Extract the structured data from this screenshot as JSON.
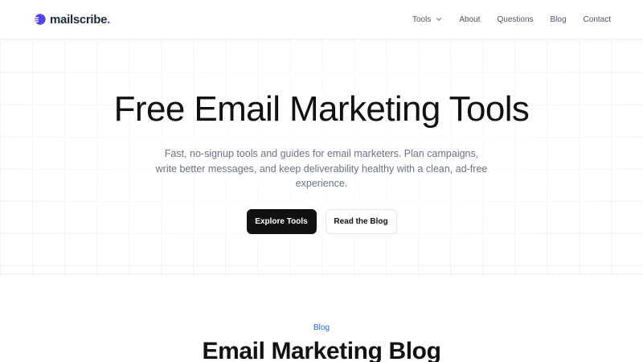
{
  "brand": {
    "name": "mailscribe",
    "dot": ".",
    "accent": "#4f46e5"
  },
  "nav": {
    "items": [
      {
        "label": "Tools",
        "has_dropdown": true
      },
      {
        "label": "About"
      },
      {
        "label": "Questions"
      },
      {
        "label": "Blog"
      },
      {
        "label": "Contact"
      }
    ]
  },
  "hero": {
    "title": "Free Email Marketing Tools",
    "subtitle": "Fast, no-signup tools and guides for email marketers. Plan campaigns, write better messages, and keep deliverability healthy with a clean, ad-free experience.",
    "primary_cta": "Explore Tools",
    "secondary_cta": "Read the Blog"
  },
  "blog": {
    "eyebrow": "Blog",
    "title": "Email Marketing Blog",
    "accent": "#2563eb"
  },
  "icons": {
    "logo": "mailscribe-logo-icon",
    "dropdown": "chevron-down-icon"
  }
}
